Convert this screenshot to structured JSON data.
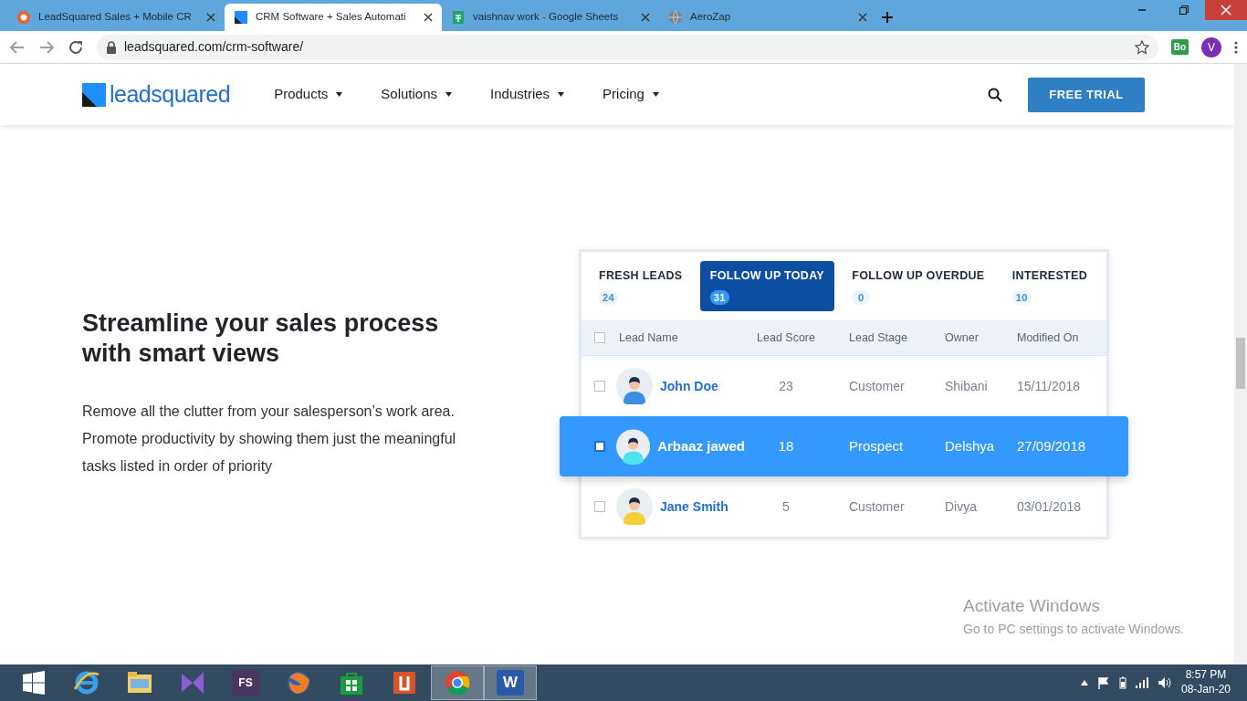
{
  "browser": {
    "tabs": [
      {
        "title": "LeadSquared Sales + Mobile CR",
        "selected": false
      },
      {
        "title": "CRM Software + Sales Automati",
        "selected": true
      },
      {
        "title": "vaishnav work - Google Sheets",
        "selected": false
      },
      {
        "title": "AeroZap",
        "selected": false
      }
    ],
    "url": "leadsquared.com/crm-software/",
    "extension_label": "Bo",
    "profile_initial": "V"
  },
  "site_nav": {
    "logo": "leadsquared",
    "menu": [
      "Products",
      "Solutions",
      "Industries",
      "Pricing"
    ],
    "cta": "FREE TRIAL"
  },
  "feature": {
    "heading": "Streamline your sales process with smart views",
    "body": "Remove all the clutter from your salesperson’s work area. Promote productivity by showing them just the meaningful tasks listed in order of priority"
  },
  "smart_views": {
    "tabs": [
      {
        "label": "FRESH LEADS",
        "count": "24",
        "selected": false
      },
      {
        "label": "FOLLOW UP TODAY",
        "count": "31",
        "selected": true
      },
      {
        "label": "FOLLOW UP OVERDUE",
        "count": "0",
        "selected": false
      },
      {
        "label": "INTERESTED",
        "count": "10",
        "selected": false
      }
    ],
    "header_checked": false,
    "columns": [
      "Lead Name",
      "Lead Score",
      "Lead Stage",
      "Owner",
      "Modified On"
    ],
    "rows": [
      {
        "name": "John Doe",
        "score": "23",
        "stage": "Customer",
        "owner": "Shibani",
        "modified": "15/11/2018",
        "selected": false,
        "checked": false
      },
      {
        "name": "Arbaaz jawed",
        "score": "18",
        "stage": "Prospect",
        "owner": "Delshya",
        "modified": "27/09/2018",
        "selected": true,
        "checked": false
      },
      {
        "name": "Jane Smith",
        "score": "5",
        "stage": "Customer",
        "owner": "Divya",
        "modified": "03/01/2018",
        "selected": false,
        "checked": false
      }
    ]
  },
  "os_notice": {
    "title": "Activate Windows",
    "text": "Go to PC settings to activate Windows."
  },
  "taskbar": {
    "apps": [
      {
        "open": false
      },
      {
        "open": false
      },
      {
        "open": false
      },
      {
        "open": false,
        "label": "FS"
      },
      {
        "open": false
      },
      {
        "open": false
      },
      {
        "open": false
      },
      {
        "open": true
      },
      {
        "open": true,
        "label": "W"
      }
    ],
    "time": "8:57 PM",
    "date": "08-Jan-20"
  }
}
